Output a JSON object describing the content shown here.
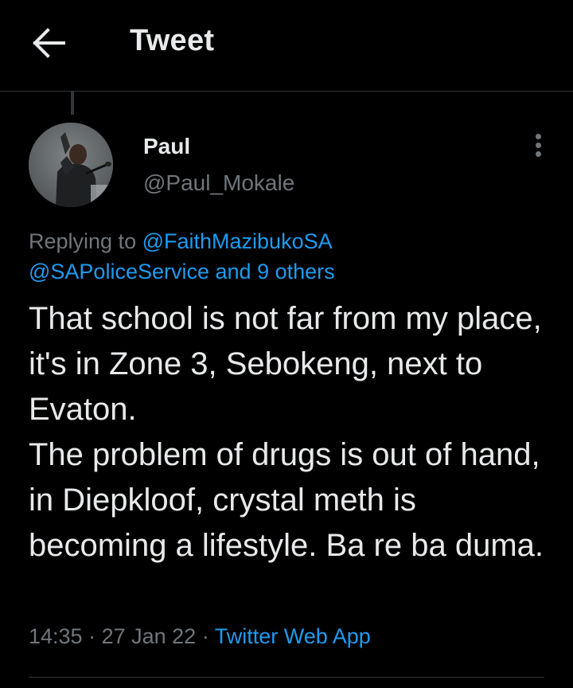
{
  "header": {
    "title": "Tweet",
    "back_icon": "arrow-left-icon"
  },
  "author": {
    "display_name": "Paul",
    "handle": "@Paul_Mokale",
    "avatar_icon": "user-avatar-photo"
  },
  "more_icon": "vertical-ellipsis-icon",
  "replying": {
    "prefix": "Replying to ",
    "mention_1": "@FaithMazibukoSA",
    "mention_2": "@SAPoliceService",
    "and_text": " and ",
    "others_link": "9 others"
  },
  "tweet": {
    "text": "That school is not far from my place, it's in Zone 3, Sebokeng, next to Evaton.\nThe problem of drugs is out of hand, in Diepkloof, crystal meth is becoming a lifestyle. Ba re ba duma."
  },
  "meta": {
    "time": "14:35",
    "separator": " · ",
    "date": "27 Jan 22",
    "source": "Twitter Web App"
  },
  "colors": {
    "background": "#000000",
    "text": "#e7e9ea",
    "secondary": "#71767b",
    "accent": "#1d9bf0",
    "divider": "#2f3336"
  }
}
